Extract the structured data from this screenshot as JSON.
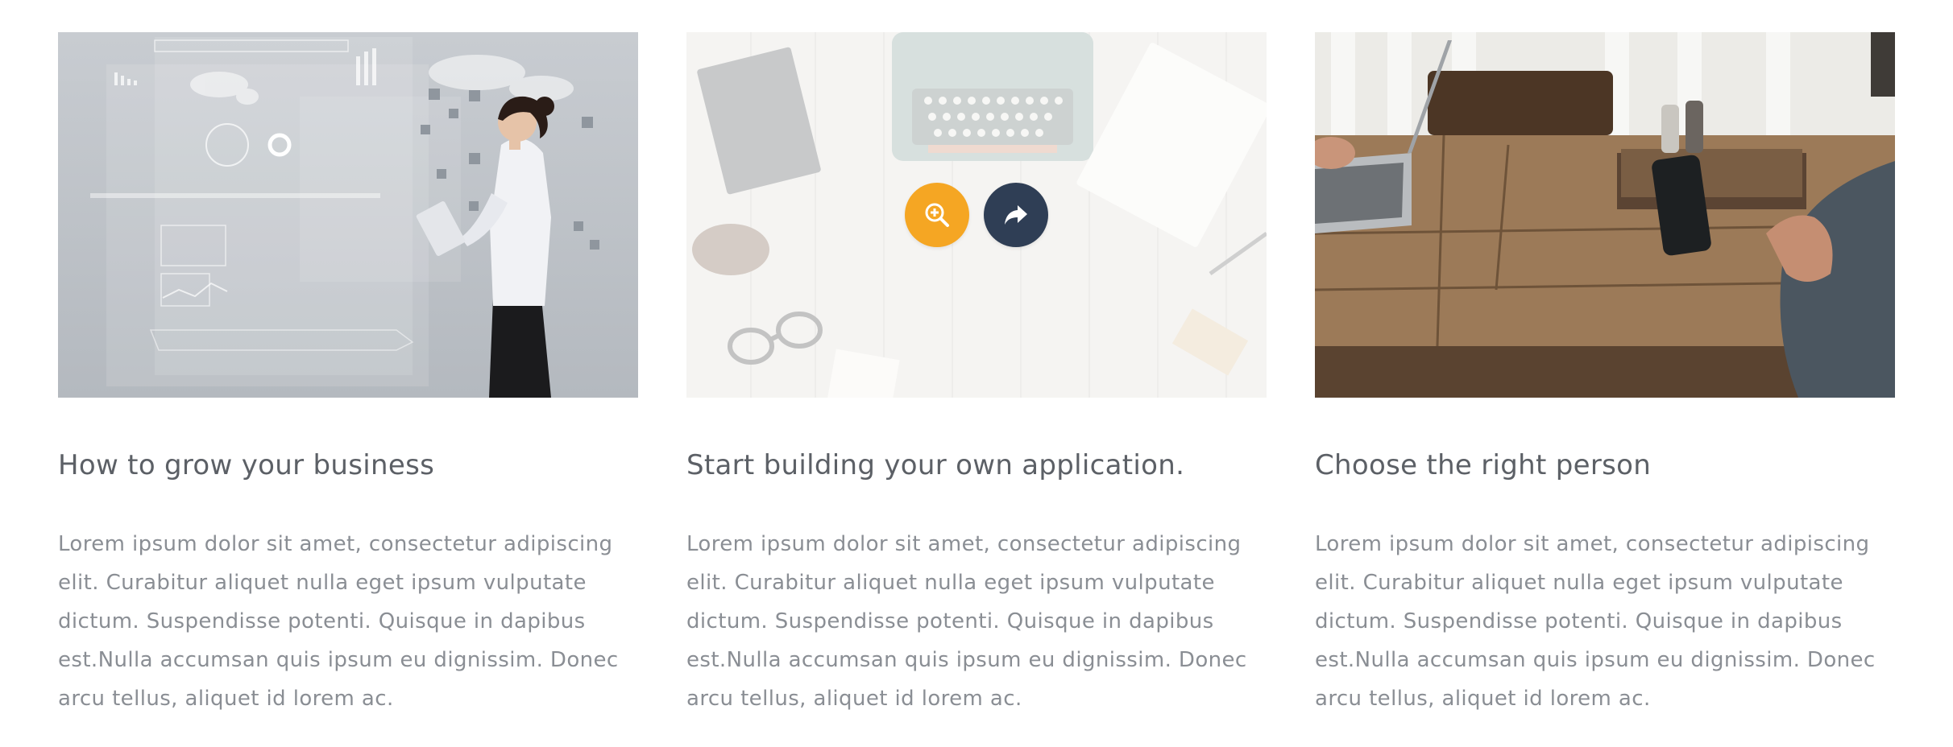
{
  "cards": [
    {
      "title": "How to grow your business",
      "text": "Lorem ipsum dolor sit amet, consectetur adipiscing elit. Curabitur aliquet nulla eget ipsum vulputate dictum. Suspendisse potenti. Quisque in dapibus est.Nulla accumsan quis ipsum eu dignissim. Donec arcu tellus, aliquet id lorem ac.",
      "image": "businesswoman-with-tablet-infographics-image"
    },
    {
      "title": "Start building your own application.",
      "text": "Lorem ipsum dolor sit amet, consectetur adipiscing elit. Curabitur aliquet nulla eget ipsum vulputate dictum. Suspendisse potenti. Quisque in dapibus est.Nulla accumsan quis ipsum eu dignissim. Donec arcu tellus, aliquet id lorem ac.",
      "image": "typewriter-desk-flatlay-image",
      "hover_actions": [
        {
          "icon": "zoom-in-icon",
          "color": "#f5a623"
        },
        {
          "icon": "share-arrow-icon",
          "color": "#2f3e55"
        }
      ]
    },
    {
      "title": "Choose the right person",
      "text": "Lorem ipsum dolor sit amet, consectetur adipiscing elit. Curabitur aliquet nulla eget ipsum vulputate dictum. Suspendisse potenti. Quisque in dapibus est.Nulla accumsan quis ipsum eu dignissim. Donec arcu tellus, aliquet id lorem ac.",
      "image": "wooden-table-laptop-phone-image"
    }
  ],
  "colors": {
    "title": "#5c6066",
    "text": "#8a8e94",
    "zoom_button": "#f5a623",
    "link_button": "#2f3e55"
  }
}
